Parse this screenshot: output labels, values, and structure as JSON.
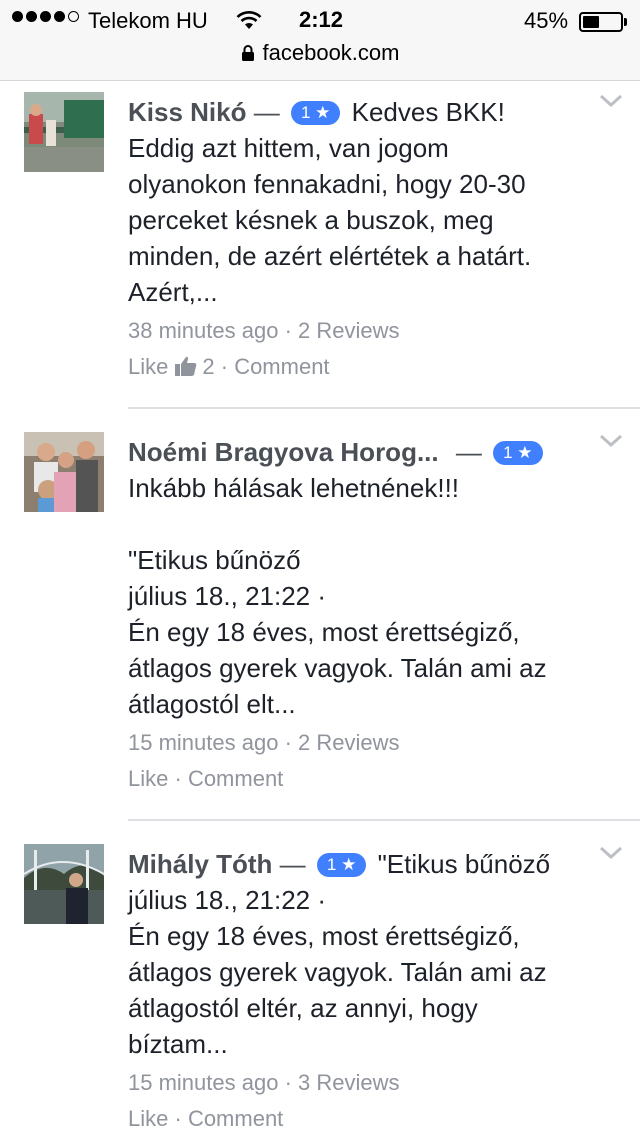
{
  "status_bar": {
    "carrier": "Telekom HU",
    "time": "2:12",
    "battery_percent": "45%",
    "battery_level": 0.45,
    "url": "facebook.com"
  },
  "reviews": [
    {
      "name": "Kiss Nikó",
      "dash": "—",
      "rating": "1 ★",
      "text": "Kedves BKK!\nEddig azt hittem, van jogom\nolyanokon fennakadni, hogy 20-30\nperceket késnek a buszok, meg\nminden, de azért elértétek a határt.\nAzért,...",
      "time": "38 minutes ago",
      "sep": "·",
      "reviews_count": "2 Reviews",
      "like": "Like",
      "like_count": "2",
      "comment": "Comment"
    },
    {
      "name": "Noémi Bragyova Horog...",
      "dash": "—",
      "rating": "1 ★",
      "text": "Inkább hálásak lehetnének!!!\n\n\"Etikus bűnöző\njúlius 18., 21:22 ·\nÉn egy 18 éves, most érettségiző,\nátlagos gyerek vagyok. Talán ami az\nátlagostól elt...",
      "time": "15 minutes ago",
      "sep": "·",
      "reviews_count": "2 Reviews",
      "like": "Like",
      "comment": "Comment"
    },
    {
      "name": "Mihály Tóth",
      "dash": "—",
      "rating": "1 ★",
      "text": "\"Etikus bűnöző\njúlius 18., 21:22 ·\nÉn egy 18 éves, most érettségiző,\nátlagos gyerek vagyok. Talán ami az\nátlagostól eltér, az annyi, hogy\nbíztam...",
      "time": "15 minutes ago",
      "sep": "·",
      "reviews_count": "3 Reviews",
      "like": "Like",
      "comment": "Comment"
    }
  ],
  "colors": {
    "badge": "#4080ff",
    "meta": "#90949c",
    "name": "#4b4f56"
  },
  "icons": [
    "wifi-icon",
    "lock-icon",
    "chevron-down-icon",
    "thumbs-up-icon"
  ]
}
